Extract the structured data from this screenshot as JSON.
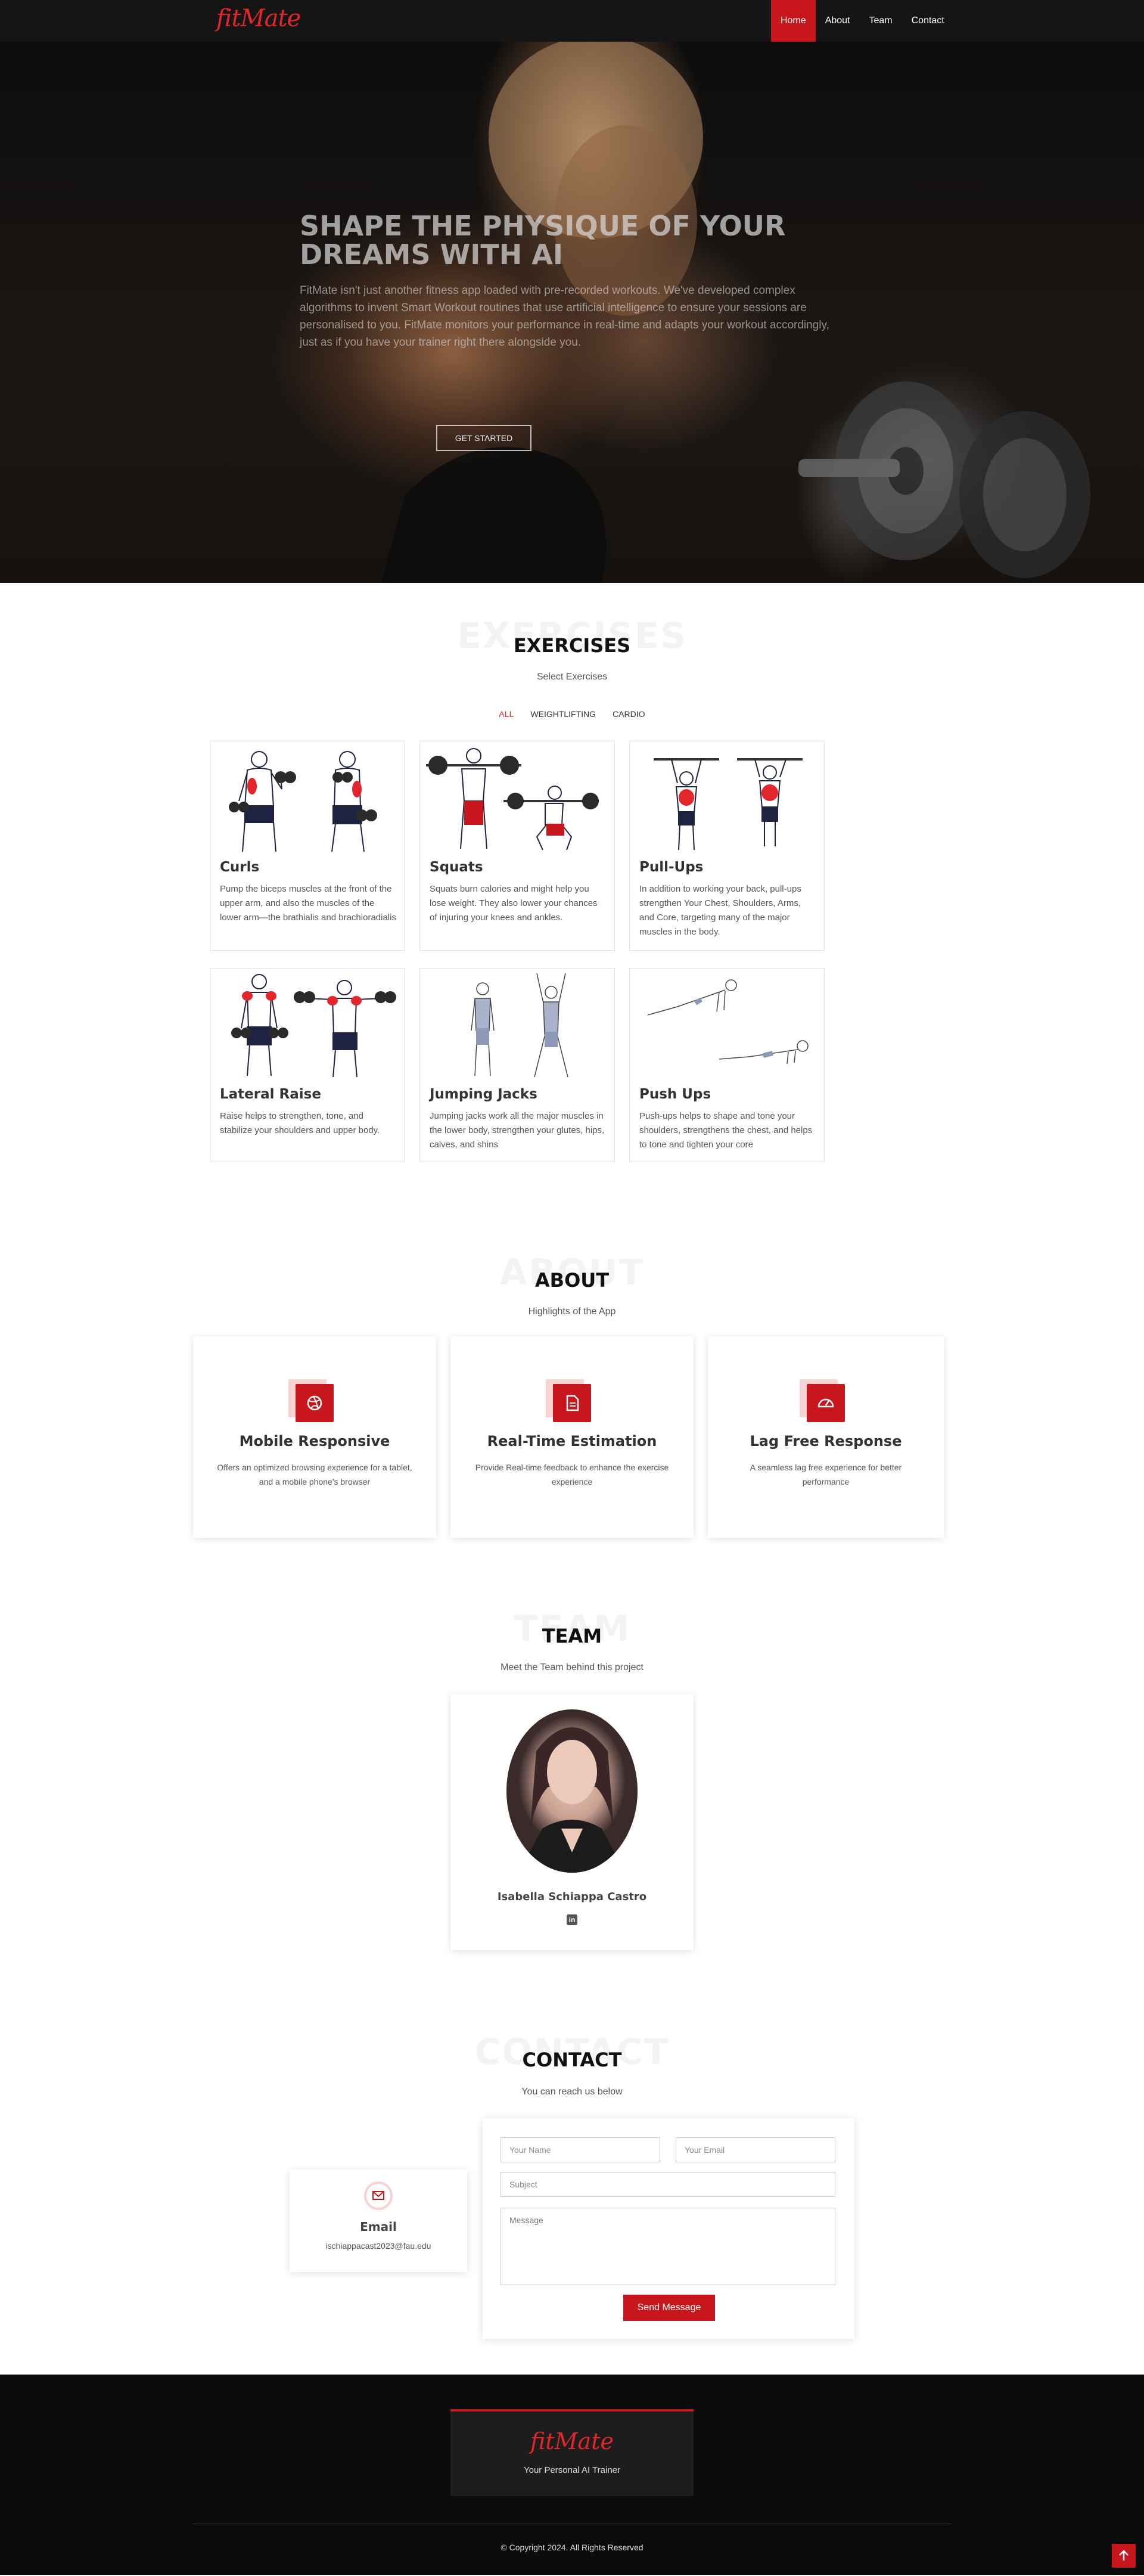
{
  "brand": {
    "logo": "fitMate",
    "accent": "#c8161d"
  },
  "nav": [
    {
      "label": "Home",
      "active": true
    },
    {
      "label": "About",
      "active": false
    },
    {
      "label": "Team",
      "active": false
    },
    {
      "label": "Contact",
      "active": false
    }
  ],
  "hero": {
    "title": "SHAPE THE PHYSIQUE OF YOUR DREAMS WITH AI",
    "description": "FitMate isn't just another fitness app loaded with pre-recorded workouts. We've developed complex algorithms to invent Smart Workout routines that use artificial intelligence to ensure your sessions are personalised to you. FitMate monitors your performance in real-time and adapts your workout accordingly, just as if you have your trainer right there alongside you.",
    "cta": "GET STARTED"
  },
  "exercises": {
    "ghost": "EXERCISES",
    "title": "EXERCISES",
    "subtitle": "Select Exercises",
    "filters": [
      {
        "label": "ALL",
        "active": true
      },
      {
        "label": "WEIGHTLIFTING",
        "active": false
      },
      {
        "label": "CARDIO",
        "active": false
      }
    ],
    "cards": [
      {
        "name": "Curls",
        "description": "Pump the biceps muscles at the front of the upper arm, and also the muscles of the lower arm—the brathialis and brachioradialis"
      },
      {
        "name": "Squats",
        "description": "Squats burn calories and might help you lose weight. They also lower your chances of injuring your knees and ankles."
      },
      {
        "name": "Pull-Ups",
        "description": "In addition to working your back, pull-ups strengthen Your Chest, Shoulders, Arms, and Core, targeting many of the major muscles in the body."
      },
      {
        "name": "Lateral Raise",
        "description": "Raise helps to strengthen, tone, and stabilize your shoulders and upper body."
      },
      {
        "name": "Jumping Jacks",
        "description": "Jumping jacks work all the major muscles in the lower body, strengthen your glutes, hips, calves, and shins"
      },
      {
        "name": "Push Ups",
        "description": "Push-ups helps to shape and tone your shoulders, strengthens the chest, and helps to tone and tighten your core"
      }
    ]
  },
  "about": {
    "ghost": "ABOUT",
    "title": "ABOUT",
    "subtitle": "Highlights of the App",
    "cards": [
      {
        "name": "Mobile Responsive",
        "description": "Offers an optimized browsing experience for a tablet, and a mobile phone's browser",
        "icon": "dribbble-icon"
      },
      {
        "name": "Real-Time Estimation",
        "description": "Provide Real-time feedback to enhance the exercise experience",
        "icon": "document-icon"
      },
      {
        "name": "Lag Free Response",
        "description": "A seamless lag free experience for better performance",
        "icon": "speedometer-icon"
      }
    ]
  },
  "team": {
    "ghost": "TEAM",
    "title": "TEAM",
    "subtitle": "Meet the Team behind this project",
    "member": {
      "name": "Isabella Schiappa Castro",
      "social": "linkedin-icon"
    }
  },
  "contact": {
    "ghost": "CONTACT",
    "title": "CONTACT",
    "subtitle": "You can reach us below",
    "email": {
      "title": "Email",
      "value": "ischiappacast2023@fau.edu"
    },
    "form": {
      "name_placeholder": "Your Name",
      "email_placeholder": "Your Email",
      "subject_placeholder": "Subject",
      "message_placeholder": "Message",
      "submit": "Send Message"
    }
  },
  "footer": {
    "logo": "fitMate",
    "tagline": "Your Personal AI Trainer",
    "copyright": "© Copyright 2024. All Rights Reserved"
  }
}
